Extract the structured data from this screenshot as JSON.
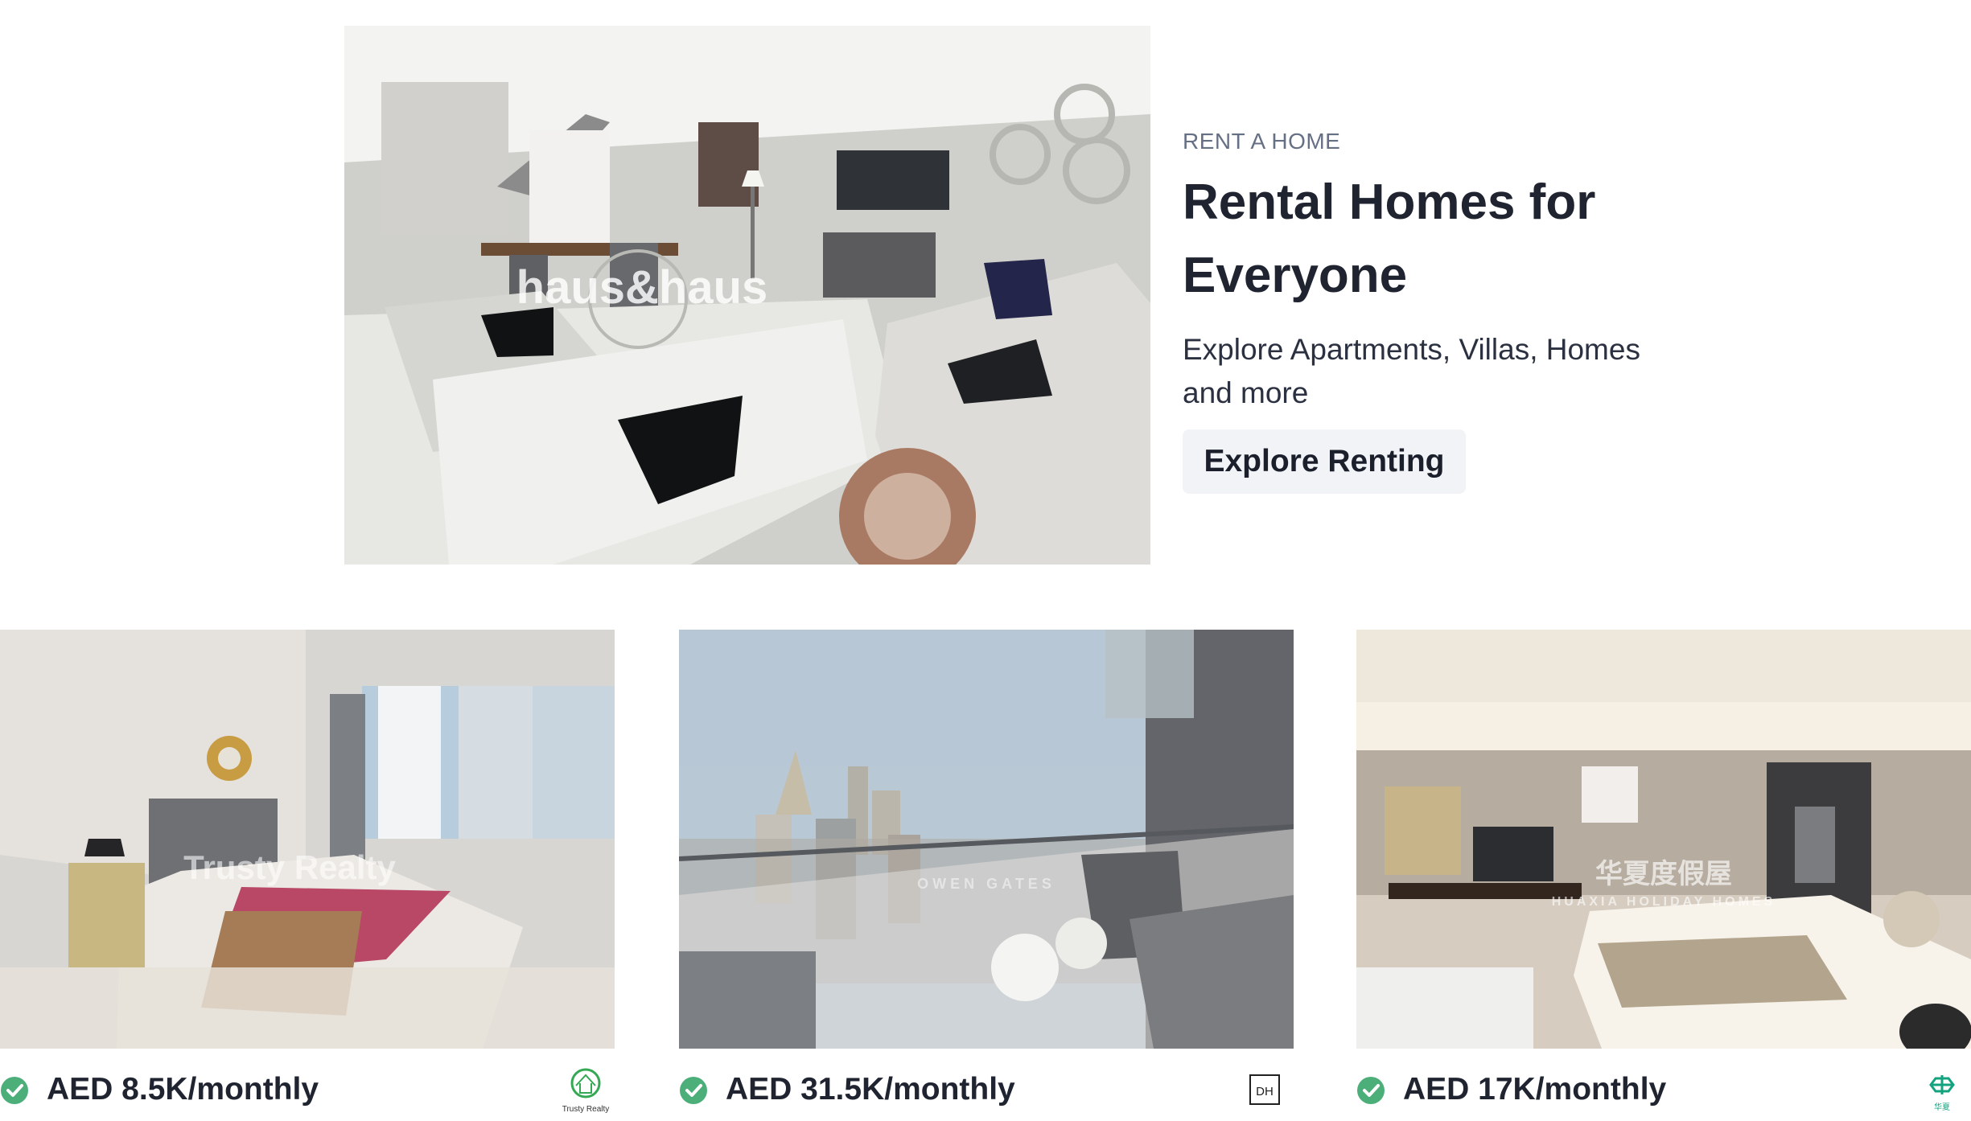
{
  "hero": {
    "eyebrow": "RENT A HOME",
    "title": "Rental Homes for Everyone",
    "subtitle": "Explore Apartments, Villas, Homes and more",
    "cta_label": "Explore Renting",
    "image_watermark": "haus&haus"
  },
  "listings": [
    {
      "price": "AED 8.5K/monthly",
      "watermark": "Trusty Realty",
      "logo_text": "Trusty Realty",
      "verified_icon": "check-circle-icon"
    },
    {
      "price": "AED 31.5K/monthly",
      "watermark": "OWEN GATES",
      "logo_text": "DH",
      "verified_icon": "check-circle-icon"
    },
    {
      "price": "AED 17K/monthly",
      "watermark": "华夏度假屋",
      "watermark_sub": "HUAXIA HOLIDAY HOMES",
      "logo_text": "华夏",
      "verified_icon": "check-circle-icon"
    }
  ],
  "colors": {
    "verified_green": "#4caf7a",
    "cta_background": "#f1f3f6",
    "eyebrow": "#667085",
    "title": "#1f2430"
  }
}
